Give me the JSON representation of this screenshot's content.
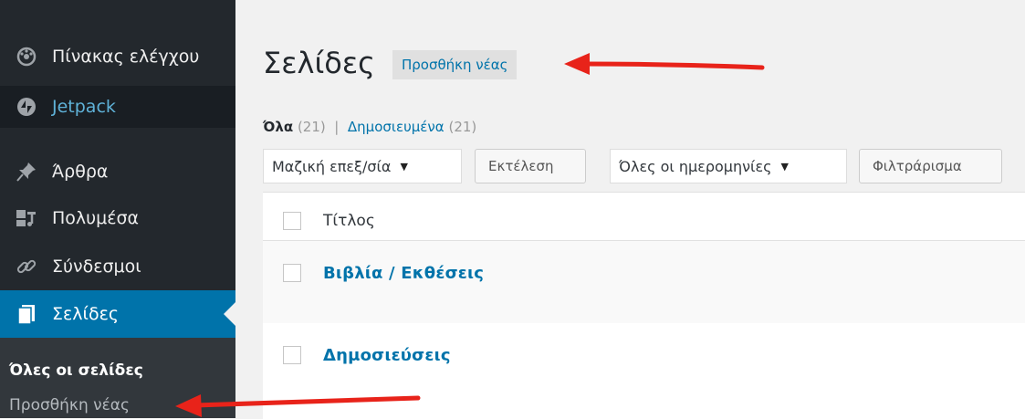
{
  "sidebar": {
    "items": [
      {
        "label": "Πίνακας ελέγχου",
        "icon": "dashboard-icon"
      },
      {
        "label": "Jetpack",
        "icon": "jetpack-icon"
      },
      {
        "label": "Άρθρα",
        "icon": "pushpin-icon"
      },
      {
        "label": "Πολυμέσα",
        "icon": "media-icon"
      },
      {
        "label": "Σύνδεσμοι",
        "icon": "link-icon"
      },
      {
        "label": "Σελίδες",
        "icon": "pages-icon"
      }
    ],
    "submenu": {
      "all_pages": "Όλες οι σελίδες",
      "add_new": "Προσθήκη νέας"
    }
  },
  "main": {
    "title": "Σελίδες",
    "add_new_label": "Προσθήκη νέας",
    "views": {
      "all_label": "Όλα",
      "all_count": "(21)",
      "separator": "|",
      "published_label": "Δημοσιευμένα",
      "published_count": "(21)"
    },
    "toolbar": {
      "bulk_actions": "Μαζική επεξ/σία",
      "apply": "Εκτέλεση",
      "all_dates": "Όλες οι ημερομηνίες",
      "filter": "Φιλτράρισμα"
    },
    "table": {
      "column_title": "Τίτλος",
      "rows": [
        {
          "title": "Βιβλία / Εκθέσεις"
        },
        {
          "title": "Δημοσιεύσεις"
        }
      ]
    }
  },
  "colors": {
    "sidebar_bg": "#23282d",
    "active_blue": "#0073aa",
    "annotation_red": "#e8231a"
  }
}
